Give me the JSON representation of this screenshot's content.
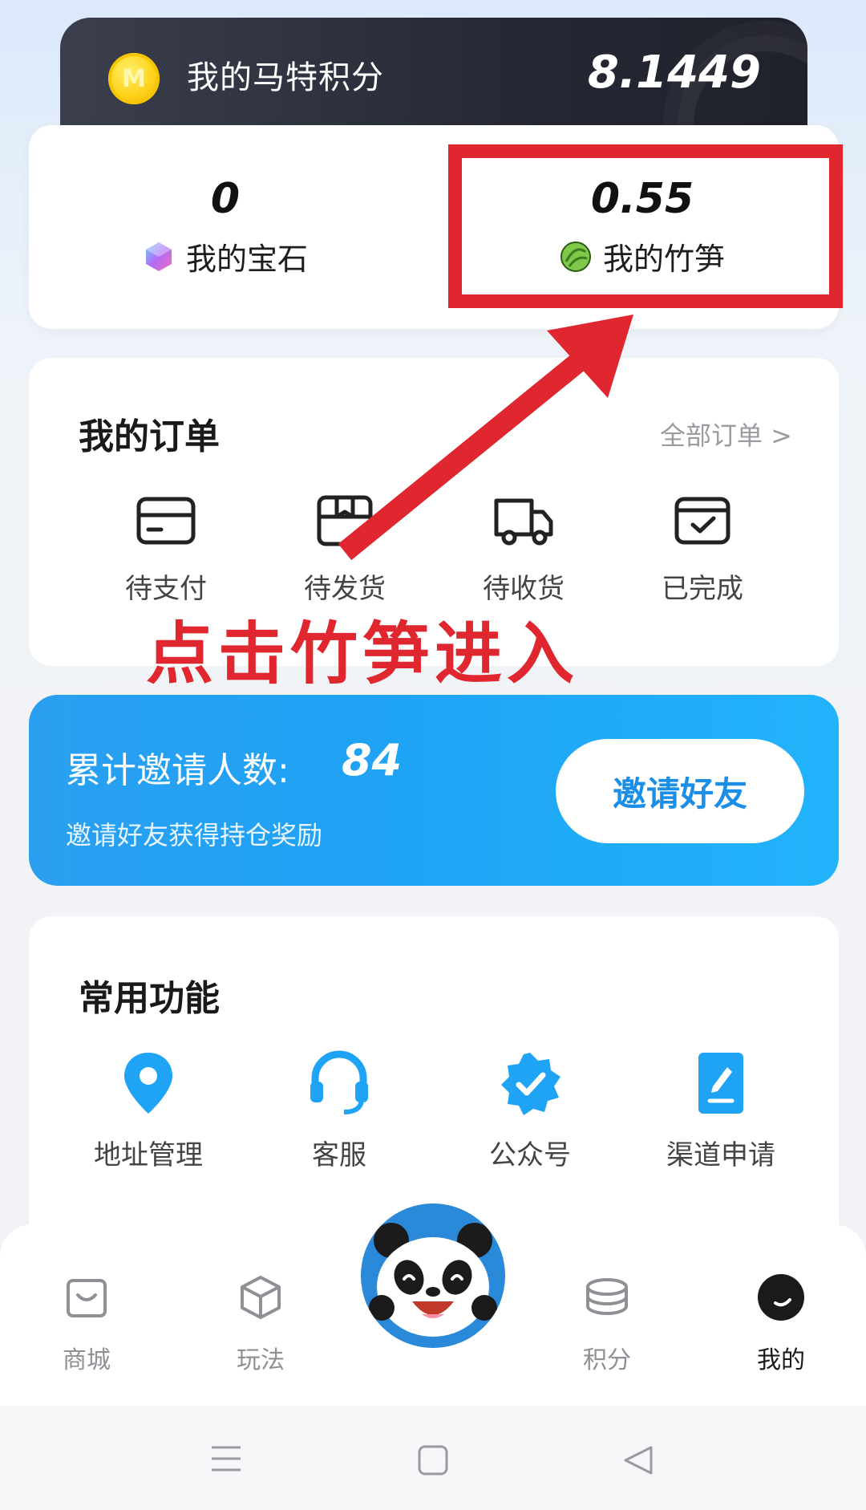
{
  "points": {
    "label": "我的马特积分",
    "value": "8.1449",
    "coin_letter": "M"
  },
  "assets": {
    "gems": {
      "value": "0",
      "label": "我的宝石",
      "icon": "gem-icon"
    },
    "bamboo": {
      "value": "0.55",
      "label": "我的竹笋",
      "icon": "bamboo-icon"
    }
  },
  "orders": {
    "title": "我的订单",
    "see_all": "全部订单 >",
    "items": [
      {
        "label": "待支付",
        "icon": "card-icon"
      },
      {
        "label": "待发货",
        "icon": "package-icon"
      },
      {
        "label": "待收货",
        "icon": "truck-icon"
      },
      {
        "label": "已完成",
        "icon": "completed-icon"
      }
    ]
  },
  "annotation": {
    "text": "点击竹笋进入",
    "color": "#e0262e"
  },
  "invite": {
    "title": "累计邀请人数:",
    "count": "84",
    "subtitle": "邀请好友获得持仓奖励",
    "button": "邀请好友"
  },
  "functions": {
    "title": "常用功能",
    "items": [
      {
        "label": "地址管理",
        "icon": "location-pin-icon"
      },
      {
        "label": "客服",
        "icon": "headset-icon"
      },
      {
        "label": "公众号",
        "icon": "verified-badge-icon"
      },
      {
        "label": "渠道申请",
        "icon": "document-edit-icon"
      }
    ]
  },
  "tabbar": {
    "items": [
      {
        "label": "商城",
        "icon": "shopping-bag-icon",
        "active": false
      },
      {
        "label": "玩法",
        "icon": "cube-icon",
        "active": false
      },
      {
        "label": "积分",
        "icon": "coins-stack-icon",
        "active": false
      },
      {
        "label": "我的",
        "icon": "profile-icon",
        "active": true
      }
    ],
    "center_icon": "panda-avatar-icon"
  },
  "colors": {
    "accent_blue": "#1fa3f5",
    "highlight_red": "#e0262e",
    "banner_dark": "#262935"
  }
}
